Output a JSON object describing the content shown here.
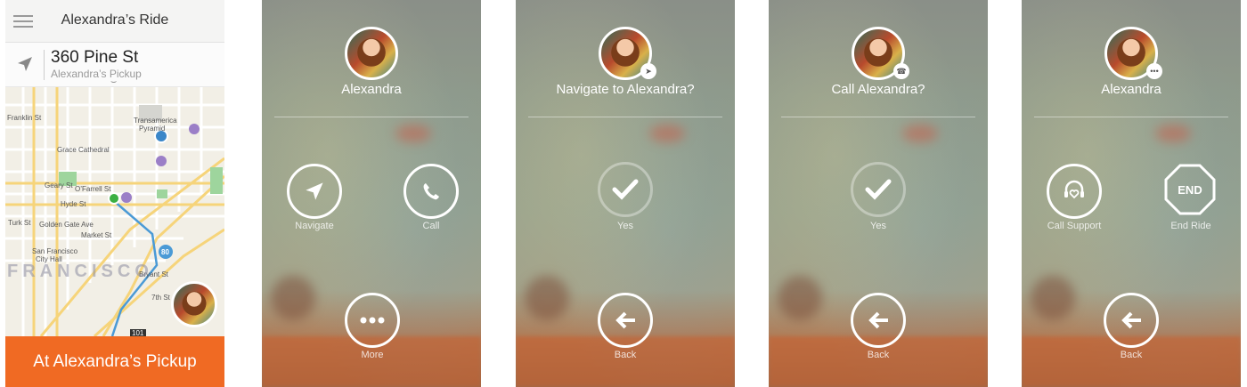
{
  "screen1": {
    "title": "Alexandra’s Ride",
    "address": "360 Pine St",
    "address_sub": "Alexandra’s Pickup",
    "map_labels": {
      "transamerica": "Transamerica",
      "pyramid": "Pyramid",
      "grace": "Grace Cathedral",
      "geary": "Geary St",
      "ofarrell": "O’Farrell St",
      "hyde": "Hyde St",
      "turk": "Turk St",
      "golden_gate": "Golden Gate Ave",
      "city_hall_1": "San Francisco",
      "city_hall_2": "City Hall",
      "franklin": "Franklin St",
      "market": "Market St",
      "bryant": "Bryant St",
      "seventh": "7th St",
      "hwy80": "80",
      "hwy101": "101",
      "city": "FRANCISCO"
    },
    "cta": "At Alexandra’s Pickup"
  },
  "screen2": {
    "name": "Alexandra",
    "navigate": "Navigate",
    "call": "Call",
    "more": "More"
  },
  "screen3": {
    "question": "Navigate to Alexandra?",
    "yes": "Yes",
    "back": "Back"
  },
  "screen4": {
    "question": "Call Alexandra?",
    "yes": "Yes",
    "back": "Back"
  },
  "screen5": {
    "name": "Alexandra",
    "support": "Call Support",
    "end_badge": "END",
    "end": "End Ride",
    "back": "Back"
  },
  "colors": {
    "accent": "#f06a23",
    "pickup_dot": "#3a86c8",
    "driver_dot": "#3cb043",
    "route": "#4a9ad6"
  }
}
